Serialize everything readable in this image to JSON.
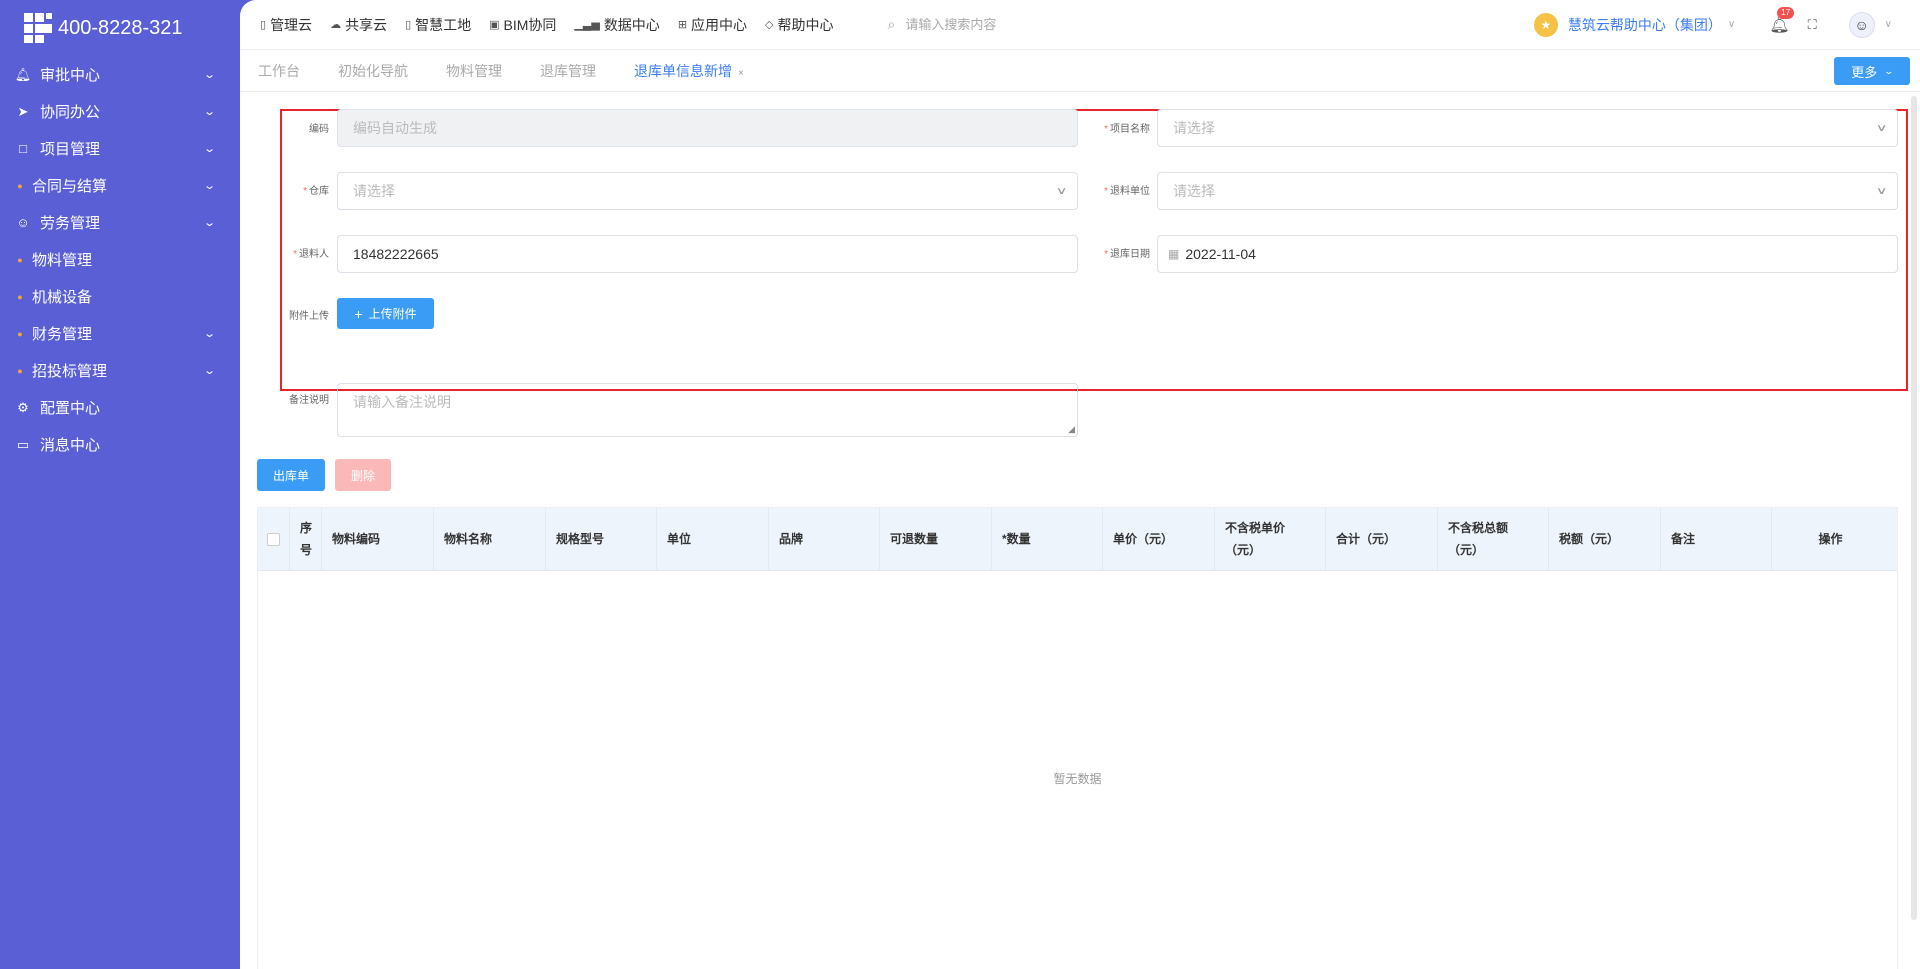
{
  "sidebar": {
    "logo_text": "400-8228-321",
    "items": [
      {
        "label": "审批中心",
        "icon": "bell-icon",
        "expandable": true
      },
      {
        "label": "协同办公",
        "icon": "send-icon",
        "expandable": true
      },
      {
        "label": "项目管理",
        "icon": "book-icon",
        "expandable": true
      },
      {
        "label": "合同与结算",
        "icon": "dot-icon",
        "expandable": true
      },
      {
        "label": "劳务管理",
        "icon": "user-icon",
        "expandable": true
      },
      {
        "label": "物料管理",
        "icon": "dot-icon",
        "expandable": false
      },
      {
        "label": "机械设备",
        "icon": "dot-icon",
        "expandable": false
      },
      {
        "label": "财务管理",
        "icon": "dot-icon",
        "expandable": true
      },
      {
        "label": "招投标管理",
        "icon": "dot-icon",
        "expandable": true
      },
      {
        "label": "配置中心",
        "icon": "gear-icon",
        "expandable": false
      },
      {
        "label": "消息中心",
        "icon": "chat-icon",
        "expandable": false
      }
    ]
  },
  "topnav": {
    "items": [
      {
        "label": "管理云",
        "icon": "doc-icon"
      },
      {
        "label": "共享云",
        "icon": "cloud-icon"
      },
      {
        "label": "智慧工地",
        "icon": "doc-icon"
      },
      {
        "label": "BIM协同",
        "icon": "cube-icon"
      },
      {
        "label": "数据中心",
        "icon": "bar-chart-icon"
      },
      {
        "label": "应用中心",
        "icon": "grid-icon"
      },
      {
        "label": "帮助中心",
        "icon": "diamond-icon"
      }
    ],
    "search_placeholder": "请输入搜索内容",
    "org_name": "慧筑云帮助中心（集团）",
    "notification_count": "17"
  },
  "tabs": {
    "items": [
      {
        "label": "工作台",
        "active": false
      },
      {
        "label": "初始化导航",
        "active": false
      },
      {
        "label": "物料管理",
        "active": false
      },
      {
        "label": "退库管理",
        "active": false
      },
      {
        "label": "退库单信息新增",
        "active": true,
        "closable": true
      }
    ],
    "close_glyph": "×",
    "more_label": "更多"
  },
  "form": {
    "code": {
      "label": "编码",
      "placeholder": "编码自动生成"
    },
    "project": {
      "label": "项目名称",
      "placeholder": "请选择"
    },
    "warehouse": {
      "label": "仓库",
      "placeholder": "请选择"
    },
    "return_unit": {
      "label": "退料单位",
      "placeholder": "请选择"
    },
    "returner": {
      "label": "退料人",
      "value": "18482222665"
    },
    "return_date": {
      "label": "退库日期",
      "value": "2022-11-04"
    },
    "attachment": {
      "label": "附件上传",
      "button_label": "上传附件"
    },
    "remark": {
      "label": "备注说明",
      "placeholder": "请输入备注说明"
    },
    "required_mark": "*"
  },
  "actions": {
    "out_label": "出库单",
    "delete_label": "删除"
  },
  "table": {
    "columns": [
      "序号",
      "物料编码",
      "物料名称",
      "规格型号",
      "单位",
      "品牌",
      "可退数量",
      "*数量",
      "单价（元）",
      "不含税单价（元）",
      "合计（元）",
      "不含税总额（元）",
      "税额（元）",
      "备注",
      "操作"
    ],
    "column_lines": [
      [
        "序",
        "号"
      ],
      [
        "物料编码"
      ],
      [
        "物料名称"
      ],
      [
        "规格型号"
      ],
      [
        "单位"
      ],
      [
        "品牌"
      ],
      [
        "可退数量"
      ],
      [
        "*数量"
      ],
      [
        "单价（元）"
      ],
      [
        "不含税单价",
        "（元）"
      ],
      [
        "合计（元）"
      ],
      [
        "不含税总额",
        "（元）"
      ],
      [
        "税额（元）"
      ],
      [
        "备注"
      ],
      [
        "操作"
      ]
    ],
    "empty_text": "暂无数据"
  },
  "colors": {
    "sidebar_bg": "#5a5fd6",
    "accent": "#3b9cf5",
    "active_tab": "#3b7ef2",
    "highlight_box": "#e8242c",
    "required": "#f56c6c"
  }
}
